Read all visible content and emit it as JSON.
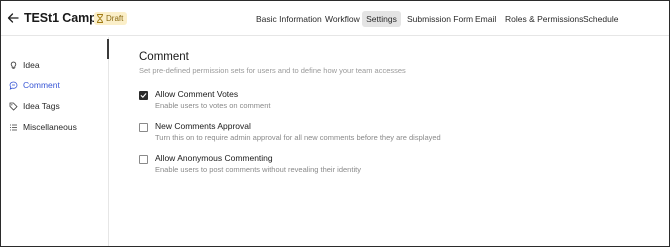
{
  "header": {
    "title": "TESt1 Campaign",
    "badge": "Draft",
    "tabs": [
      {
        "label": "Basic Information",
        "active": false
      },
      {
        "label": "Workflow",
        "active": false
      },
      {
        "label": "Settings",
        "active": true
      },
      {
        "label": "Submission Form",
        "active": false
      },
      {
        "label": "Email",
        "active": false
      },
      {
        "label": "Roles & Permissions",
        "active": false
      },
      {
        "label": "Schedule",
        "active": false
      }
    ]
  },
  "sidebar": {
    "items": [
      {
        "label": "Idea",
        "icon": "lightbulb-icon",
        "active": false
      },
      {
        "label": "Comment",
        "icon": "comment-icon",
        "active": true
      },
      {
        "label": "Idea Tags",
        "icon": "tag-icon",
        "active": false
      },
      {
        "label": "Miscellaneous",
        "icon": "list-icon",
        "active": false
      }
    ]
  },
  "main": {
    "heading": "Comment",
    "subheading": "Set pre-defined permission sets for users and to define how your team accesses",
    "options": [
      {
        "title": "Allow Comment Votes",
        "description": "Enable users to votes on comment",
        "checked": true
      },
      {
        "title": "New Comments Approval",
        "description": "Turn this on to require admin approval for all new comments before they are displayed",
        "checked": false
      },
      {
        "title": "Allow Anonymous Commenting",
        "description": "Enable users to post comments without revealing their identity",
        "checked": false
      }
    ]
  },
  "colors": {
    "accent": "#3957d6",
    "badge_bg": "#fbefc9",
    "badge_text": "#8a6a12",
    "active_tab_bg": "#e4e4e4"
  }
}
